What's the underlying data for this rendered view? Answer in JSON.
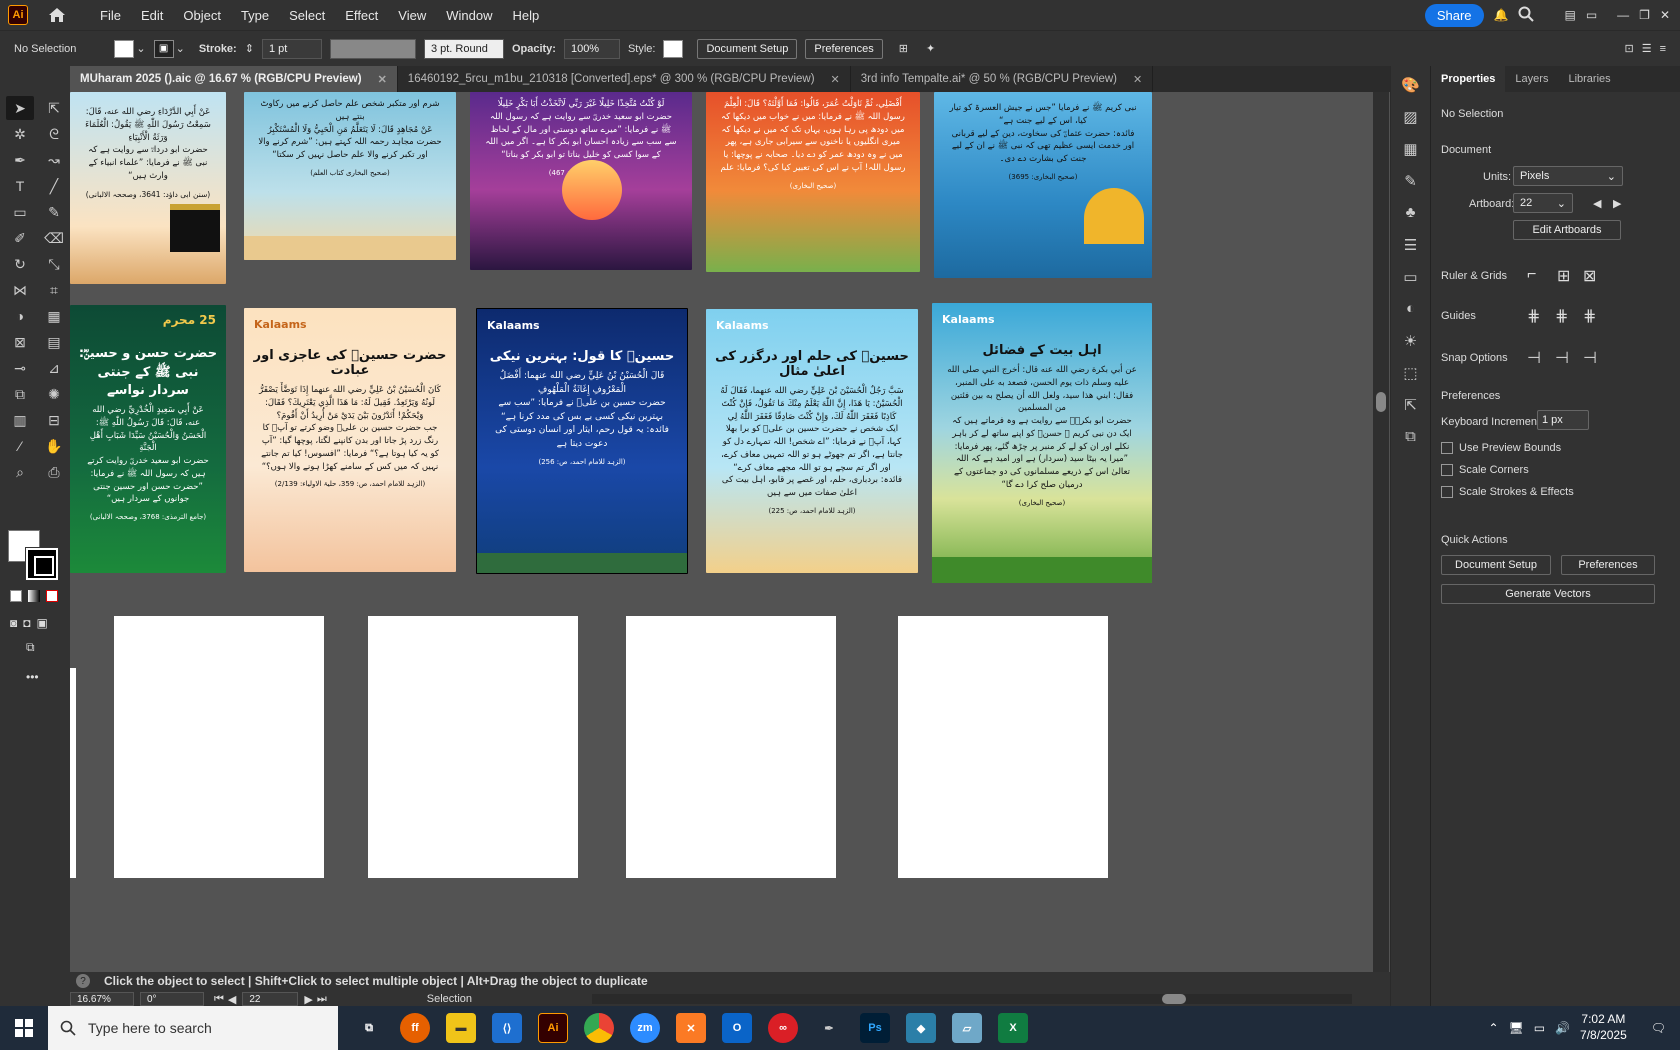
{
  "menu": {
    "items": [
      "File",
      "Edit",
      "Object",
      "Type",
      "Select",
      "Effect",
      "View",
      "Window",
      "Help"
    ],
    "share": "Share"
  },
  "control": {
    "selection": "No Selection",
    "stroke_label": "Stroke:",
    "stroke_value": "1 pt",
    "brush": "3 pt. Round",
    "opacity_label": "Opacity:",
    "opacity_value": "100%",
    "style_label": "Style:",
    "doc_setup": "Document Setup",
    "preferences": "Preferences"
  },
  "tabs": [
    {
      "label": "MUharam 2025 ().aic @ 16.67 % (RGB/CPU Preview)"
    },
    {
      "label": "16460192_5rcu_m1bu_210318 [Converted].eps* @ 300 % (RGB/CPU Preview)"
    },
    {
      "label": "3rd info Tempalte.ai* @ 50 % (RGB/CPU Preview)"
    }
  ],
  "cards": {
    "row1": [
      {
        "text": "عَنْ أَبِي الدَّرْدَاءِ رضي الله عنه، قَالَ: سَمِعْتُ رَسُولَ اللّٰهِ ﷺ يَقُولُ: الْعُلَمَاءَ وَرَثَةُ الْأَنْبِيَاءِ\nحضرت ابو درداءؓ سے روایت ہے کہ نبی ﷺ نے فرمایا: ”علماء انبیاء کے وارث ہیں“",
        "ref": "(سنن ابی داؤد: 3641، وصححہ الالبانی)"
      },
      {
        "text": "شرم اور متکبر شخص علم حاصل کرنے میں رکاوٹ بنتے ہیں\nعَنْ مُجَاهِدٍ قَالَ: لَا يَتَعَلَّمُ مَنِ الْحَيِيُّ وَلَا الْمُسْتَكْبِرُ\nحضرت مجاہد رحمہ اللہ کہتے ہیں: ”شرم کرنے والا اور تکبر کرنے والا علم حاصل نہیں کر سکتا“",
        "ref": "(صحیح البخاری کتاب العلم)"
      },
      {
        "text": "لَوْ كُنْتُ مُتَّخِذًا خَلِيلًا غَيْرَ رَبِّي لَاتَّخَذْتُ أَبَا بَكْرٍ خَلِيلًا\nحضرت ابو سعید خدریؓ سے روایت ہے کہ رسول اللہ ﷺ نے فرمایا: ”میرے ساتھ دوستی اور مال کے لحاظ سے سب سے زیادہ احسان ابو بکر کا ہے۔ اگر میں اللہ کے سوا کسی کو خلیل بناتا تو ابو بکر کو بناتا“",
        "ref": "(صحیح البخاری: 467)"
      },
      {
        "text": "أَفْضَلِي، ثُمَّ نَاوَلْتُ عُمَرَ، قَالُوا: فَمَا أَوَّلْتَهُ؟ قَالَ: الْعِلْمَ\nرسول اللہ ﷺ نے فرمایا: میں نے خواب میں دیکھا کہ میں دودھ پی رہا ہوں، یہاں تک کہ میں نے دیکھا کہ میری انگلیوں یا ناخنوں سے سیرابی جاری ہے، پھر میں نے وہ دودھ عمر کو دے دیا۔ صحابہ نے پوچھا: یا رسول اللہ! آپ نے اس کی تعبیر کیا کی؟ فرمایا: علم",
        "ref": "(صحیح البخاری)"
      },
      {
        "text": "نبی کریم ﷺ نے فرمایا ”جس نے جیش العسرۃ کو تیار کیا، اس کے لیے جنت ہے“\nفائدہ: حضرت عثمانؓ کی سخاوت، دین کے لیے قربانی اور خدمت ایسی عظیم تھی کہ نبی ﷺ نے ان کے لیے جنت کی بشارت دے دی۔",
        "ref": "(صحیح البخاری: 3695)"
      }
    ],
    "row2": [
      {
        "logo": "25 محرم",
        "title": "حضرت حسن و حسینؓ: نبی ﷺ کے جنتی سردار نواسے",
        "text": "عَنْ أَبِي سَعِيدٍ الْخُدْرِيِّ رضي الله عنه، قَالَ: قَالَ رَسُولُ اللّٰهِ ﷺ: الْحَسَنُ وَالْحُسَيْنُ سَيِّدَا شَبَابِ أَهْلِ الْجَنَّةِ\nحضرت ابو سعید خدریؓ روایت کرتے ہیں کہ رسول اللہ ﷺ نے فرمایا: ”حضرت حسن اور حسین جنتی جوانوں کے سردار ہیں“",
        "ref": "(جامع الترمذی: 3768، وصححہ الالبانی)"
      },
      {
        "logo": "Kalaams",
        "title": "حضرت حسینؓ کی عاجزی اور عبادت",
        "text": "كَانَ الْحُسَيْنُ بْنُ عَلِيٍّ رضي الله عنهما إِذَا تَوَضَّأَ يَصْفَرُّ لَونُهُ وَيَرْتَعِدُ. فَقِيلَ لَهُ: مَا هَذَا الَّذِي يَعْتَرِيكَ؟ فَقَالَ: وَيْحَكُمْ! أَتَدْرُونَ بَيْنَ يَدَيْ مَنْ أُرِيدُ أَنْ أَقُومَ؟\nجب حضرت حسین بن علیؓ وضو کرتے تو آپؓ کا رنگ زرد پڑ جاتا اور بدن کانپنے لگتا، پوچھا گیا: ”آپ کو یہ کیا ہوتا ہے؟“ فرمایا: ”افسوس! کیا تم جانتے نہیں کہ میں کس کے سامنے کھڑا ہونے والا ہوں؟“",
        "ref": "(الزہد للامام احمد، ص: 359، حلیۃ الاولیاء: 2/139)"
      },
      {
        "logo": "Kalaams",
        "title": "حسینؓ کا قول: بہترین نیکی",
        "text": "قَالَ الْحُسَيْنُ بْنُ عَلِيٍّ رضي الله عنهما: أَفْضَلُ الْمَعْرُوفِ إِغَاثَةُ الْمَلْهُوفِ\nحضرت حسین بن علیؓ نے فرمایا: ”سب سے بہترین نیکی کسی بے بس کی مدد کرنا ہے“\nفائدہ: یہ قول رحم، ایثار اور انسان دوستی کی دعوت دیتا ہے",
        "ref": "(الزہد للامام احمد، ص: 256)"
      },
      {
        "logo": "Kalaams",
        "title": "حسینؓ کی حلم اور درگزر کی اعلیٰ مثال",
        "text": "سَبَّ رَجُلٌ الْحُسَيْنَ بْنَ عَلِيٍّ رضي الله عنهما، فَقَالَ لَهُ الْحُسَيْنُ: يَا هَذَا، إِنَّ اللّٰهَ يَعْلَمُ مِنْكَ مَا تَقُولُ، فَإِنْ كُنْتَ كَاذِبًا فَغَفَرَ اللّٰهُ لَكَ، وَإِنْ كُنْتَ صَادِقًا فَغَفَرَ اللّٰهُ لِي\nایک شخص نے حضرت حسین بن علیؓ کو برا بھلا کہا، آپؓ نے فرمایا: ”اے شخص! اللہ تمہارے دل کو جانتا ہے، اگر تم جھوٹے ہو تو اللہ تمہیں معاف کرے، اور اگر تم سچے ہو تو اللہ مجھے معاف کرے“\nفائدہ: بردباری، حلم، اور غصے پر قابو، اہل بیت کی اعلیٰ صفات میں سے ہیں",
        "ref": "(الزہد للامام احمد، ص: 225)"
      },
      {
        "logo": "Kalaams",
        "title": "اہل بیت کے فضائل",
        "text": "عن أبي بكرة رضي الله عنه قال: أخرج النبي صلى الله عليه وسلم ذات يوم الحسن، فصعد به على المنبر، فقال: ابني هذا سيد، ولعل الله أن يصلح به بين فئتين من المسلمين\nحضرت ابو بکرہؓ سے روایت ہے وہ فرماتے ہیں کہ ایک دن نبی کریم ﷺ حسنؓ کو اپنے ساتھ لے کر باہر نکلے اور ان کو لے کر منبر پر چڑھ گئے، پھر فرمایا: ”میرا یہ بیٹا سید (سردار) ہے اور امید ہے کہ اللہ تعالیٰ اس کے ذریعے مسلمانوں کی دو جماعتوں کے درمیان صلح کرا دے گا“",
        "ref": "(صحیح البخاری)"
      }
    ]
  },
  "panel": {
    "tabs": [
      "Properties",
      "Layers",
      "Libraries"
    ],
    "selection": "No Selection",
    "document": "Document",
    "units_label": "Units:",
    "units_value": "Pixels",
    "artboard_label": "Artboard:",
    "artboard_value": "22",
    "edit_artboards": "Edit Artboards",
    "rulers": "Ruler & Grids",
    "guides": "Guides",
    "snap": "Snap Options",
    "prefs_title": "Preferences",
    "kb_label": "Keyboard Increment:",
    "kb_value": "1 px",
    "chk1": "Use Preview Bounds",
    "chk2": "Scale Corners",
    "chk3": "Scale Strokes & Effects",
    "quick": "Quick Actions",
    "qa_doc": "Document Setup",
    "qa_pref": "Preferences",
    "qa_vec": "Generate Vectors"
  },
  "status": {
    "hint": "Click the object to select | Shift+Click to select multiple object | Alt+Drag the object to duplicate",
    "zoom": "16.67%",
    "angle": "0°",
    "artboard": "22",
    "mode": "Selection"
  },
  "taskbar": {
    "search": "Type here to search",
    "time": "7:02 AM",
    "date": "7/8/2025"
  }
}
